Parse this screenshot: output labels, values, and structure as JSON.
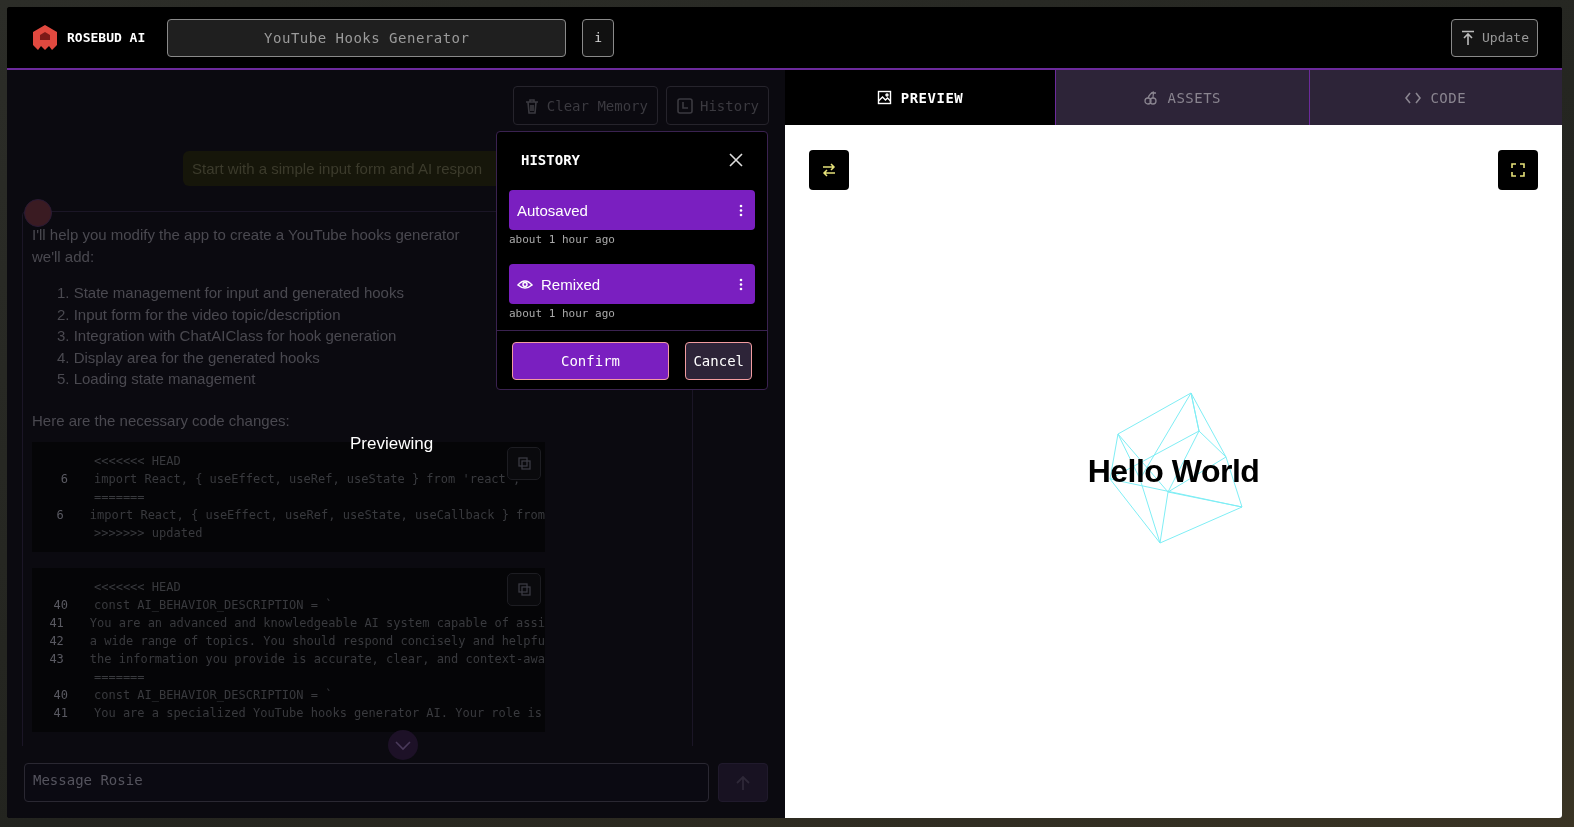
{
  "header": {
    "logo_text": "ROSEBUD AI",
    "project_title": "YouTube Hooks Generator",
    "info_button": "i",
    "update_button": "Update"
  },
  "chat": {
    "toolbar": [
      "Clear Memory",
      "History"
    ],
    "user_message": "Start with a simple input form and AI respon",
    "assistant": {
      "intro_lines": [
        "I'll help you modify the app to create a YouTube hooks generator",
        "we'll add:"
      ],
      "list": [
        "1. State management for input and generated hooks",
        "2. Input form for the video topic/description",
        "3. Integration with ChatAIClass for hook generation",
        "4. Display area for the generated hooks",
        "5. Loading state management"
      ],
      "outro": "Here are the necessary code changes:",
      "code_blocks": [
        {
          "lines": [
            {
              "text": "<<<<<<< HEAD"
            },
            {
              "number": "6",
              "text": "import React, { useEffect, useRef, useState } from 'react';"
            },
            {
              "text": "======="
            },
            {
              "number": "6",
              "text": "import React, { useEffect, useRef, useState, useCallback } from"
            },
            {
              "text": ">>>>>>> updated"
            }
          ]
        },
        {
          "lines": [
            {
              "text": "<<<<<<< HEAD"
            },
            {
              "number": "40",
              "text": "const AI_BEHAVIOR_DESCRIPTION = `"
            },
            {
              "number": "41",
              "text": "You are an advanced and knowledgeable AI system capable of assi"
            },
            {
              "number": "42",
              "text": "a wide range of topics. You should respond concisely and helpfu"
            },
            {
              "number": "43",
              "text": "the information you provide is accurate, clear, and context-awa"
            },
            {
              "text": "======="
            },
            {
              "number": "40",
              "text": "const AI_BEHAVIOR_DESCRIPTION = `"
            },
            {
              "number": "41",
              "text": "You are a specialized YouTube hooks generator AI. Your role is"
            }
          ]
        }
      ]
    },
    "previewing_label": "Previewing",
    "message_placeholder": "Message Rosie"
  },
  "history": {
    "title": "HISTORY",
    "items": [
      {
        "label": "Autosaved",
        "time": "about 1 hour ago",
        "previewing": false
      },
      {
        "label": "Remixed",
        "time": "about 1 hour ago",
        "previewing": true
      }
    ],
    "buttons": [
      "Confirm",
      "Cancel"
    ]
  },
  "preview": {
    "tabs": [
      {
        "label": "PREVIEW",
        "selected": true
      },
      {
        "label": "ASSETS",
        "selected": false
      },
      {
        "label": "CODE",
        "selected": false
      }
    ],
    "heading": "Hello World"
  }
}
